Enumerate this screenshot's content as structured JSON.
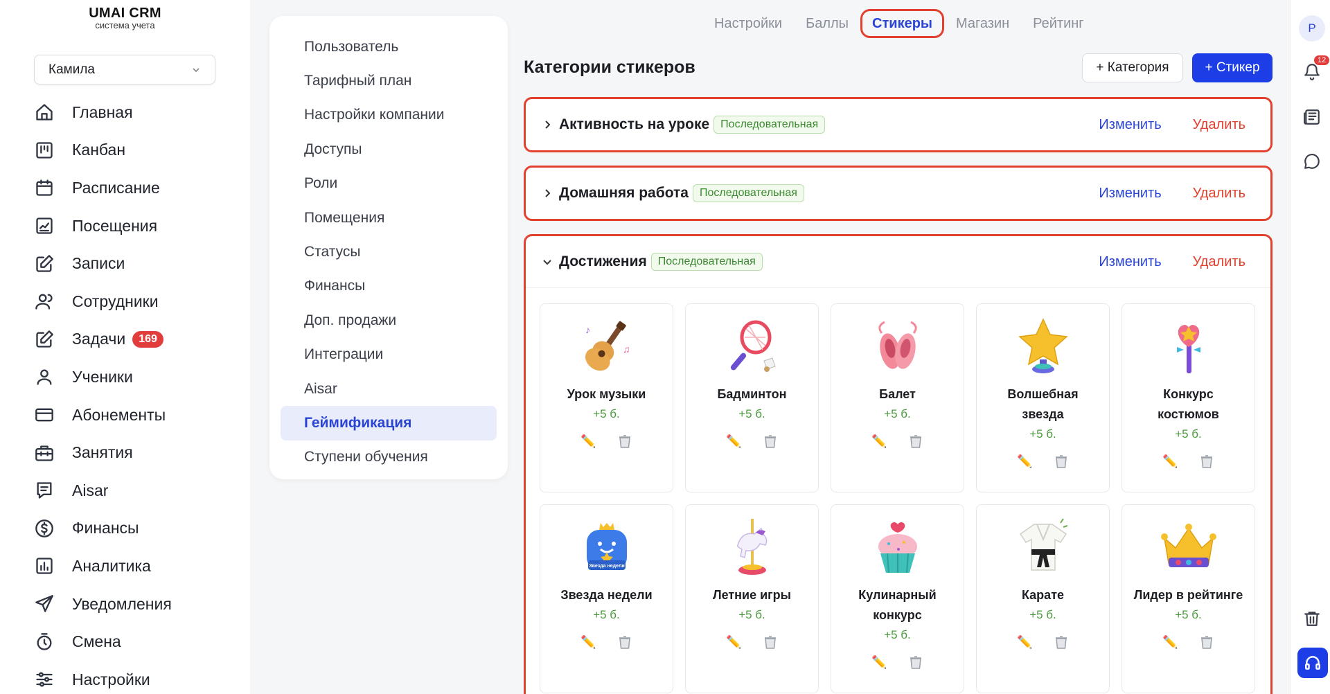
{
  "app": {
    "title": "UMAI CRM",
    "subtitle": "система учета"
  },
  "user_select": {
    "value": "Камила"
  },
  "nav": [
    {
      "label": "Главная",
      "icon": "home-icon"
    },
    {
      "label": "Канбан",
      "icon": "kanban-icon"
    },
    {
      "label": "Расписание",
      "icon": "calendar-icon"
    },
    {
      "label": "Посещения",
      "icon": "chart-icon"
    },
    {
      "label": "Записи",
      "icon": "edit-icon"
    },
    {
      "label": "Сотрудники",
      "icon": "users-icon"
    },
    {
      "label": "Задачи",
      "icon": "tasks-icon",
      "badge": "169"
    },
    {
      "label": "Ученики",
      "icon": "user-icon"
    },
    {
      "label": "Абонементы",
      "icon": "card-icon"
    },
    {
      "label": "Занятия",
      "icon": "briefcase-icon"
    },
    {
      "label": "Aisar",
      "icon": "message-icon"
    },
    {
      "label": "Финансы",
      "icon": "dollar-icon"
    },
    {
      "label": "Аналитика",
      "icon": "analytics-icon"
    },
    {
      "label": "Уведомления",
      "icon": "send-icon"
    },
    {
      "label": "Смена",
      "icon": "timer-icon"
    },
    {
      "label": "Настройки",
      "icon": "sliders-icon"
    }
  ],
  "settings_menu": [
    {
      "label": "Пользователь"
    },
    {
      "label": "Тарифный план"
    },
    {
      "label": "Настройки компании"
    },
    {
      "label": "Доступы"
    },
    {
      "label": "Роли"
    },
    {
      "label": "Помещения"
    },
    {
      "label": "Статусы"
    },
    {
      "label": "Финансы"
    },
    {
      "label": "Доп. продажи"
    },
    {
      "label": "Интеграции"
    },
    {
      "label": "Aisar"
    },
    {
      "label": "Геймификация",
      "active": true
    },
    {
      "label": "Ступени обучения"
    }
  ],
  "tabs": [
    {
      "label": "Настройки"
    },
    {
      "label": "Баллы"
    },
    {
      "label": "Стикеры",
      "active": true
    },
    {
      "label": "Магазин"
    },
    {
      "label": "Рейтинг"
    }
  ],
  "header": {
    "title": "Категории стикеров",
    "add_category": "+ Категория",
    "add_sticker": "+ Стикер"
  },
  "categories": [
    {
      "name": "Активность на уроке",
      "tag": "Последовательная",
      "edit": "Изменить",
      "delete": "Удалить",
      "expanded": false
    },
    {
      "name": "Домашняя работа",
      "tag": "Последовательная",
      "edit": "Изменить",
      "delete": "Удалить",
      "expanded": false
    },
    {
      "name": "Достижения",
      "tag": "Последовательная",
      "edit": "Изменить",
      "delete": "Удалить",
      "expanded": true
    }
  ],
  "stickers": [
    {
      "name": "Урок музыки",
      "points": "+5 б.",
      "icon": "guitar-icon"
    },
    {
      "name": "Бадминтон",
      "points": "+5 б.",
      "icon": "badminton-icon"
    },
    {
      "name": "Балет",
      "points": "+5 б.",
      "icon": "ballet-shoes-icon"
    },
    {
      "name": "Волшебная звезда",
      "points": "+5 б.",
      "icon": "star-icon"
    },
    {
      "name": "Конкурс костюмов",
      "points": "+5 б.",
      "icon": "magic-wand-icon"
    },
    {
      "name": "Звезда недели",
      "points": "+5 б.",
      "icon": "star-week-icon",
      "icon_text": "Звезда недели"
    },
    {
      "name": "Летние игры",
      "points": "+5 б.",
      "icon": "carousel-horse-icon"
    },
    {
      "name": "Кулинарный конкурс",
      "points": "+5 б.",
      "icon": "cupcake-icon"
    },
    {
      "name": "Карате",
      "points": "+5 б.",
      "icon": "kimono-icon"
    },
    {
      "name": "Лидер в рейтинге",
      "points": "+5 б.",
      "icon": "crown-icon"
    }
  ],
  "rail": {
    "avatar": "P",
    "notifications": "12"
  },
  "colors": {
    "accent": "#1d3ee6",
    "highlight": "#e2412f",
    "tag_green": "#3a8a2f",
    "points_green": "#4a9a3c"
  }
}
